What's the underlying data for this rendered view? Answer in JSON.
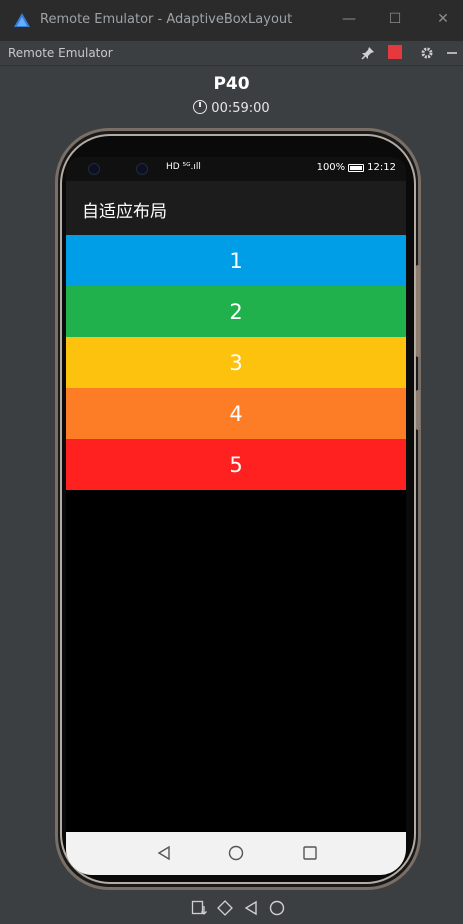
{
  "window": {
    "title": "Remote Emulator - AdaptiveBoxLayout",
    "minimize_glyph": "—",
    "maximize_glyph": "☐",
    "close_glyph": "✕"
  },
  "toolbar": {
    "title": "Remote Emulator",
    "icons": [
      "pin-icon",
      "stop-record-icon",
      "gear-icon",
      "minimize-panel-icon"
    ]
  },
  "device": {
    "name": "P40",
    "timer": "00:59:00"
  },
  "status_bar": {
    "network": "HD ⁵ᴳ.ıll",
    "battery": "100%",
    "time": "12:12"
  },
  "app": {
    "title": "自适应布局",
    "boxes": [
      {
        "label": "1",
        "color": "#009ee6"
      },
      {
        "label": "2",
        "color": "#21b14c"
      },
      {
        "label": "3",
        "color": "#fdc20d"
      },
      {
        "label": "4",
        "color": "#fd7d27"
      },
      {
        "label": "5",
        "color": "#ff2020"
      }
    ]
  },
  "nav_bar": {
    "icons": [
      "back-triangle-icon",
      "home-circle-icon",
      "recents-square-icon"
    ]
  },
  "bottom_controls": {
    "icons": [
      "screenshot-icon",
      "rotate-icon",
      "back-icon",
      "home-icon"
    ]
  },
  "colors": {
    "accent_record": "#e5393d",
    "background": "#3c3f41"
  }
}
